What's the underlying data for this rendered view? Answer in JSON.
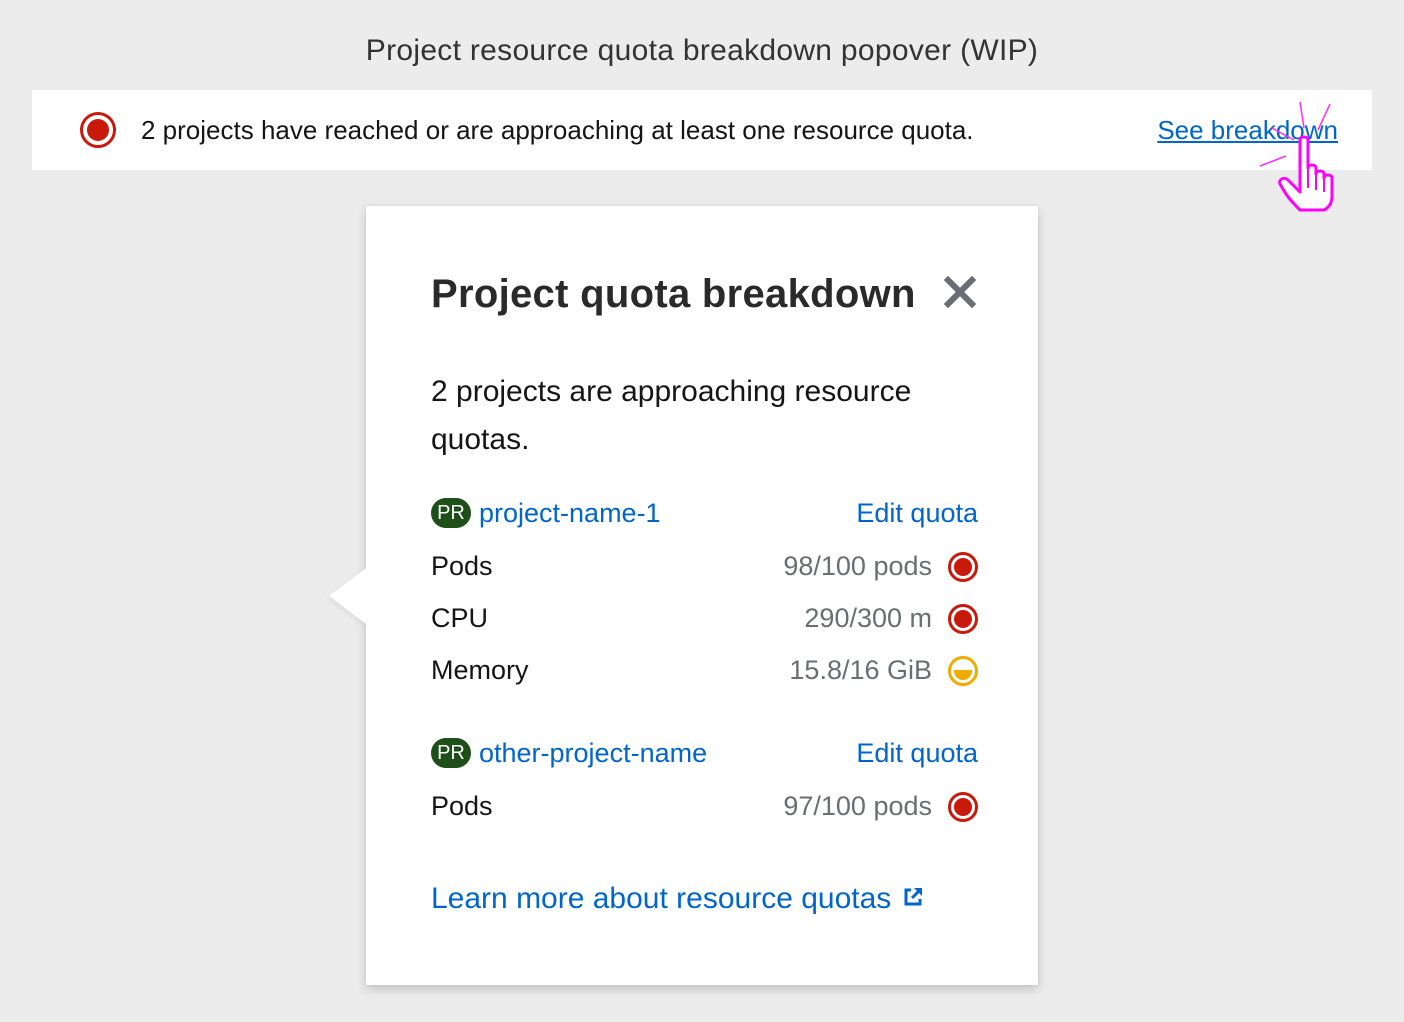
{
  "page": {
    "title": "Project resource quota breakdown popover (WIP)"
  },
  "alert": {
    "icon": "danger-circle-icon",
    "message": "2 projects have reached or are approaching at least one resource quota.",
    "link_label": "See breakdown",
    "cursor_icon": "hand-pointer-icon"
  },
  "popover": {
    "title": "Project quota breakdown",
    "close_icon": "close-icon",
    "body": "2 projects are approaching resource quotas.",
    "projects": [
      {
        "badge": "PR",
        "name": "project-name-1",
        "edit_label": "Edit quota",
        "quotas": [
          {
            "label": "Pods",
            "value": "98/100 pods",
            "status": "danger"
          },
          {
            "label": "CPU",
            "value": "290/300 m",
            "status": "danger"
          },
          {
            "label": "Memory",
            "value": "15.8/16 GiB",
            "status": "warning"
          }
        ]
      },
      {
        "badge": "PR",
        "name": "other-project-name",
        "edit_label": "Edit quota",
        "quotas": [
          {
            "label": "Pods",
            "value": "97/100 pods",
            "status": "danger"
          }
        ]
      }
    ],
    "learn_more_label": "Learn more about resource quotas",
    "external_link_icon": "external-link-icon"
  },
  "colors": {
    "background": "#ececec",
    "link": "#0066cc",
    "danger": "#c9190b",
    "warning": "#f0ab00",
    "badge": "#1e4f18",
    "cursor_highlight": "#ff00ff"
  }
}
